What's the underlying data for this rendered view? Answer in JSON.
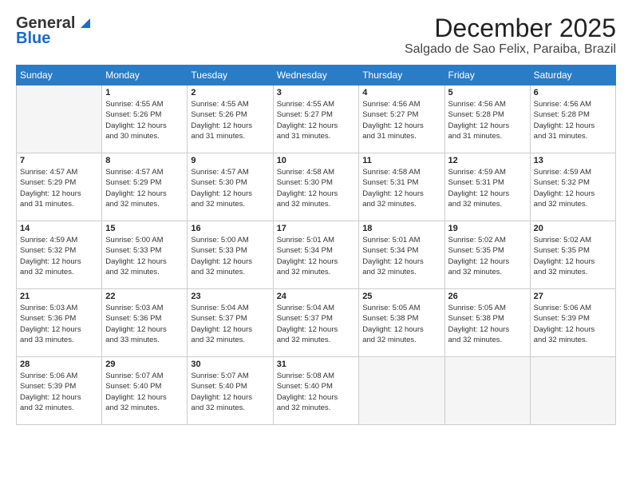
{
  "logo": {
    "line1": "General",
    "line2": "Blue"
  },
  "title": "December 2025",
  "subtitle": "Salgado de Sao Felix, Paraiba, Brazil",
  "header_days": [
    "Sunday",
    "Monday",
    "Tuesday",
    "Wednesday",
    "Thursday",
    "Friday",
    "Saturday"
  ],
  "weeks": [
    [
      {
        "day": "",
        "info": ""
      },
      {
        "day": "1",
        "info": "Sunrise: 4:55 AM\nSunset: 5:26 PM\nDaylight: 12 hours\nand 30 minutes."
      },
      {
        "day": "2",
        "info": "Sunrise: 4:55 AM\nSunset: 5:26 PM\nDaylight: 12 hours\nand 31 minutes."
      },
      {
        "day": "3",
        "info": "Sunrise: 4:55 AM\nSunset: 5:27 PM\nDaylight: 12 hours\nand 31 minutes."
      },
      {
        "day": "4",
        "info": "Sunrise: 4:56 AM\nSunset: 5:27 PM\nDaylight: 12 hours\nand 31 minutes."
      },
      {
        "day": "5",
        "info": "Sunrise: 4:56 AM\nSunset: 5:28 PM\nDaylight: 12 hours\nand 31 minutes."
      },
      {
        "day": "6",
        "info": "Sunrise: 4:56 AM\nSunset: 5:28 PM\nDaylight: 12 hours\nand 31 minutes."
      }
    ],
    [
      {
        "day": "7",
        "info": "Sunrise: 4:57 AM\nSunset: 5:29 PM\nDaylight: 12 hours\nand 31 minutes."
      },
      {
        "day": "8",
        "info": "Sunrise: 4:57 AM\nSunset: 5:29 PM\nDaylight: 12 hours\nand 32 minutes."
      },
      {
        "day": "9",
        "info": "Sunrise: 4:57 AM\nSunset: 5:30 PM\nDaylight: 12 hours\nand 32 minutes."
      },
      {
        "day": "10",
        "info": "Sunrise: 4:58 AM\nSunset: 5:30 PM\nDaylight: 12 hours\nand 32 minutes."
      },
      {
        "day": "11",
        "info": "Sunrise: 4:58 AM\nSunset: 5:31 PM\nDaylight: 12 hours\nand 32 minutes."
      },
      {
        "day": "12",
        "info": "Sunrise: 4:59 AM\nSunset: 5:31 PM\nDaylight: 12 hours\nand 32 minutes."
      },
      {
        "day": "13",
        "info": "Sunrise: 4:59 AM\nSunset: 5:32 PM\nDaylight: 12 hours\nand 32 minutes."
      }
    ],
    [
      {
        "day": "14",
        "info": "Sunrise: 4:59 AM\nSunset: 5:32 PM\nDaylight: 12 hours\nand 32 minutes."
      },
      {
        "day": "15",
        "info": "Sunrise: 5:00 AM\nSunset: 5:33 PM\nDaylight: 12 hours\nand 32 minutes."
      },
      {
        "day": "16",
        "info": "Sunrise: 5:00 AM\nSunset: 5:33 PM\nDaylight: 12 hours\nand 32 minutes."
      },
      {
        "day": "17",
        "info": "Sunrise: 5:01 AM\nSunset: 5:34 PM\nDaylight: 12 hours\nand 32 minutes."
      },
      {
        "day": "18",
        "info": "Sunrise: 5:01 AM\nSunset: 5:34 PM\nDaylight: 12 hours\nand 32 minutes."
      },
      {
        "day": "19",
        "info": "Sunrise: 5:02 AM\nSunset: 5:35 PM\nDaylight: 12 hours\nand 32 minutes."
      },
      {
        "day": "20",
        "info": "Sunrise: 5:02 AM\nSunset: 5:35 PM\nDaylight: 12 hours\nand 32 minutes."
      }
    ],
    [
      {
        "day": "21",
        "info": "Sunrise: 5:03 AM\nSunset: 5:36 PM\nDaylight: 12 hours\nand 33 minutes."
      },
      {
        "day": "22",
        "info": "Sunrise: 5:03 AM\nSunset: 5:36 PM\nDaylight: 12 hours\nand 33 minutes."
      },
      {
        "day": "23",
        "info": "Sunrise: 5:04 AM\nSunset: 5:37 PM\nDaylight: 12 hours\nand 32 minutes."
      },
      {
        "day": "24",
        "info": "Sunrise: 5:04 AM\nSunset: 5:37 PM\nDaylight: 12 hours\nand 32 minutes."
      },
      {
        "day": "25",
        "info": "Sunrise: 5:05 AM\nSunset: 5:38 PM\nDaylight: 12 hours\nand 32 minutes."
      },
      {
        "day": "26",
        "info": "Sunrise: 5:05 AM\nSunset: 5:38 PM\nDaylight: 12 hours\nand 32 minutes."
      },
      {
        "day": "27",
        "info": "Sunrise: 5:06 AM\nSunset: 5:39 PM\nDaylight: 12 hours\nand 32 minutes."
      }
    ],
    [
      {
        "day": "28",
        "info": "Sunrise: 5:06 AM\nSunset: 5:39 PM\nDaylight: 12 hours\nand 32 minutes."
      },
      {
        "day": "29",
        "info": "Sunrise: 5:07 AM\nSunset: 5:40 PM\nDaylight: 12 hours\nand 32 minutes."
      },
      {
        "day": "30",
        "info": "Sunrise: 5:07 AM\nSunset: 5:40 PM\nDaylight: 12 hours\nand 32 minutes."
      },
      {
        "day": "31",
        "info": "Sunrise: 5:08 AM\nSunset: 5:40 PM\nDaylight: 12 hours\nand 32 minutes."
      },
      {
        "day": "",
        "info": ""
      },
      {
        "day": "",
        "info": ""
      },
      {
        "day": "",
        "info": ""
      }
    ]
  ]
}
